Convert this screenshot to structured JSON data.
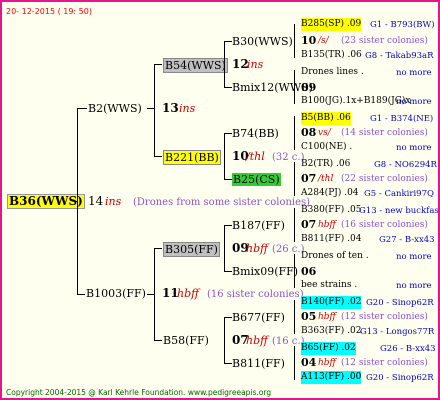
{
  "header": {
    "date": "20- 12-2015 ( 19: 50)"
  },
  "root": {
    "name": "B36(WWS)",
    "number": "14",
    "ins": "ins",
    "note": "(Drones from some sister colonies)"
  },
  "gen1": [
    {
      "name": "B2(WWS)",
      "number": "13",
      "ins": "ins"
    },
    {
      "name": "B1003(FF)",
      "number": "11",
      "ins": "hbff",
      "note": "(16 sister colonies)"
    }
  ],
  "gen2": [
    {
      "name": "B54(WWS)",
      "number": "12",
      "ins": "ins"
    },
    {
      "name": "B221(BB)",
      "number": "10",
      "ins": "/thl",
      "note": "(32 c.)"
    },
    {
      "name": "B305(FF)",
      "number": "09",
      "ins": "hbff",
      "note": "(26 c.)"
    },
    {
      "name": "B58(FF)",
      "number": "07",
      "ins": "hbff",
      "note": "(16 c.)"
    }
  ],
  "gen3": [
    {
      "name": "B30(WWS)",
      "number": "10",
      "ins": ""
    },
    {
      "name": "Bmix12(WWS)",
      "number": "09",
      "ins": ""
    },
    {
      "name": "B74(BB)",
      "number": "08",
      "ins": ""
    },
    {
      "name": "B25(CS)",
      "number": "07",
      "ins": ""
    },
    {
      "name": "B187(FF)",
      "number": "07",
      "ins": ""
    },
    {
      "name": "Bmix09(FF)",
      "number": "06",
      "ins": ""
    },
    {
      "name": "B677(FF)",
      "number": "05",
      "ins": ""
    },
    {
      "name": "B811(FF)",
      "number": "04",
      "ins": ""
    }
  ],
  "gen4": [
    {
      "top": "B285(SP) .09",
      "topref": "G1 - B793(BW)",
      "mid_num": "10",
      "mid_ins": "/s/",
      "mid_note": "(23 sister colonies)",
      "bot": "B135(TR) .06",
      "botref": "G8 - Takab93aR"
    },
    {
      "top": "Drones lines .",
      "topref": "no more",
      "mid_num": "09",
      "mid_ins": "",
      "mid_note": "",
      "bot": "B100(JG).1x+B189(JG)x",
      "botref": "no more"
    },
    {
      "top": "B5(BB) .06",
      "topref": "G1 - B374(NE)",
      "mid_num": "08",
      "mid_ins": "vs/",
      "mid_note": "(14 sister colonies)",
      "bot": "C100(NE) .",
      "botref": "no more"
    },
    {
      "top": "B2(TR) .06",
      "topref": "G8 - NO6294R",
      "mid_num": "07",
      "mid_ins": "/thl",
      "mid_note": "(22 sister colonies)",
      "bot": "A284(PJ) .04",
      "botref": "G5 - Cankiri97Q"
    },
    {
      "top": "B380(FF) .05",
      "topref": "G13 - new buckfas",
      "mid_num": "07",
      "mid_ins": "hbff",
      "mid_note": "(16 sister colonies)",
      "bot": "B811(FF) .04",
      "botref": "G27 - B-xx43"
    },
    {
      "top": "Drones of ten .",
      "topref": "no more",
      "mid_num": "06",
      "mid_ins": "",
      "mid_note": "",
      "bot": "bee strains .",
      "botref": "no more"
    },
    {
      "top": "B140(FF) .02",
      "topref": "G20 - Sinop62R",
      "mid_num": "05",
      "mid_ins": "hbff",
      "mid_note": "(12 sister colonies)",
      "bot": "B363(FF) .02",
      "botref": "G13 - Longos77R"
    },
    {
      "top": "B65(FF) .02",
      "topref": "G26 - B-xx43",
      "mid_num": "04",
      "mid_ins": "hbff",
      "mid_note": "(12 sister colonies)",
      "bot": "A113(FF) .00",
      "botref": "G20 - Sinop62R"
    }
  ],
  "footer": {
    "copyright": "Copyright 2004-2015 @ Karl Kehrle Foundation.",
    "site": "www.pedigreeapis.org"
  }
}
